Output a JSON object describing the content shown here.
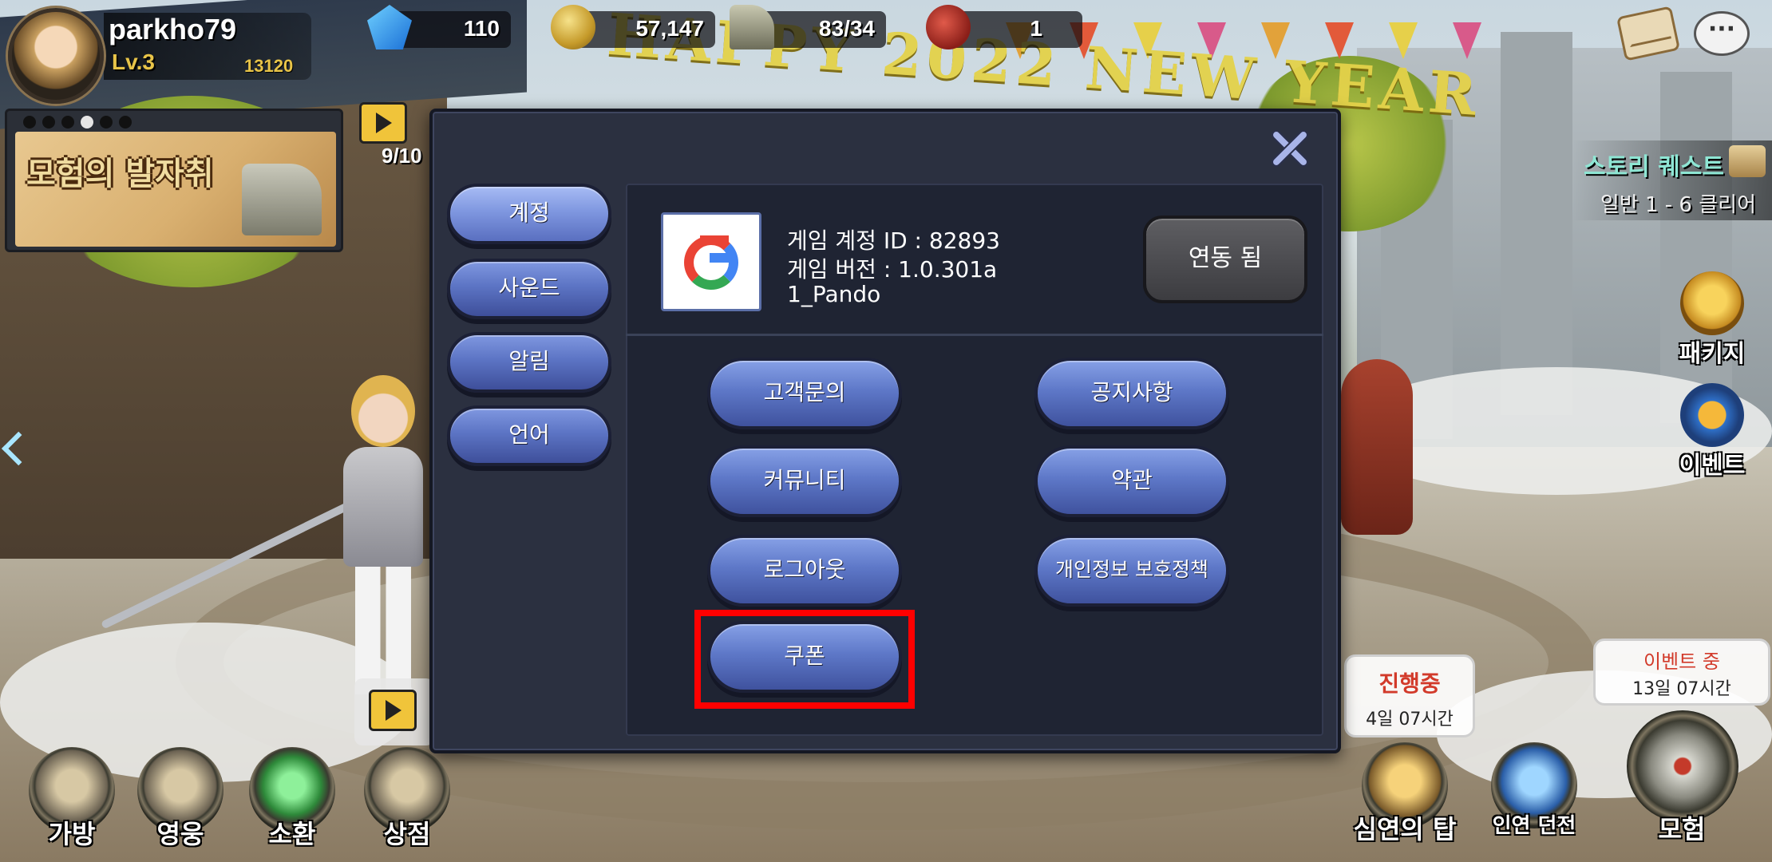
{
  "player": {
    "name": "parkho79",
    "level": "Lv.3",
    "exp": "13120"
  },
  "resources": {
    "gems": "110",
    "gold": "57,147",
    "stamina": "83/34",
    "meat": "1"
  },
  "background": {
    "banner_text": "HAPPY 2022 NEW YEAR"
  },
  "event_banner": {
    "title": "모험의 발자취",
    "dots": 6,
    "active_dot": 4
  },
  "ad_counter": {
    "label": "9/10"
  },
  "story_quest": {
    "title": "스토리 퀘스트",
    "progress": "일반 1 - 6 클리어"
  },
  "side_buttons": {
    "package": "패키지",
    "event": "이벤트"
  },
  "bottom_nav": {
    "bag": "가방",
    "hero": "영웅",
    "summon": "소환",
    "shop": "상점"
  },
  "bottom_right": {
    "tower_status": "진행중",
    "tower_time": "4일 07시간",
    "tower_label": "심연의 탑",
    "dungeon_label": "인연 던전",
    "event_status": "이벤트 중",
    "event_time": "13일 07시간",
    "adventure_label": "모험"
  },
  "settings": {
    "tabs": [
      "계정",
      "사운드",
      "알림",
      "언어"
    ],
    "active_tab": "계정",
    "account_id": "게임 계정 ID : 82893",
    "version": "게임 버전 : 1.0.301a",
    "build": "1_Pando",
    "linked_label": "연동 됨",
    "buttons": {
      "support": "고객문의",
      "notice": "공지사항",
      "community": "커뮤니티",
      "terms": "약관",
      "logout": "로그아웃",
      "privacy": "개인정보 보호정책",
      "coupon": "쿠폰"
    }
  },
  "colors": {
    "highlight": "#ff0000",
    "button_blue": "#5e78c8",
    "modal_bg": "#2b3040"
  }
}
